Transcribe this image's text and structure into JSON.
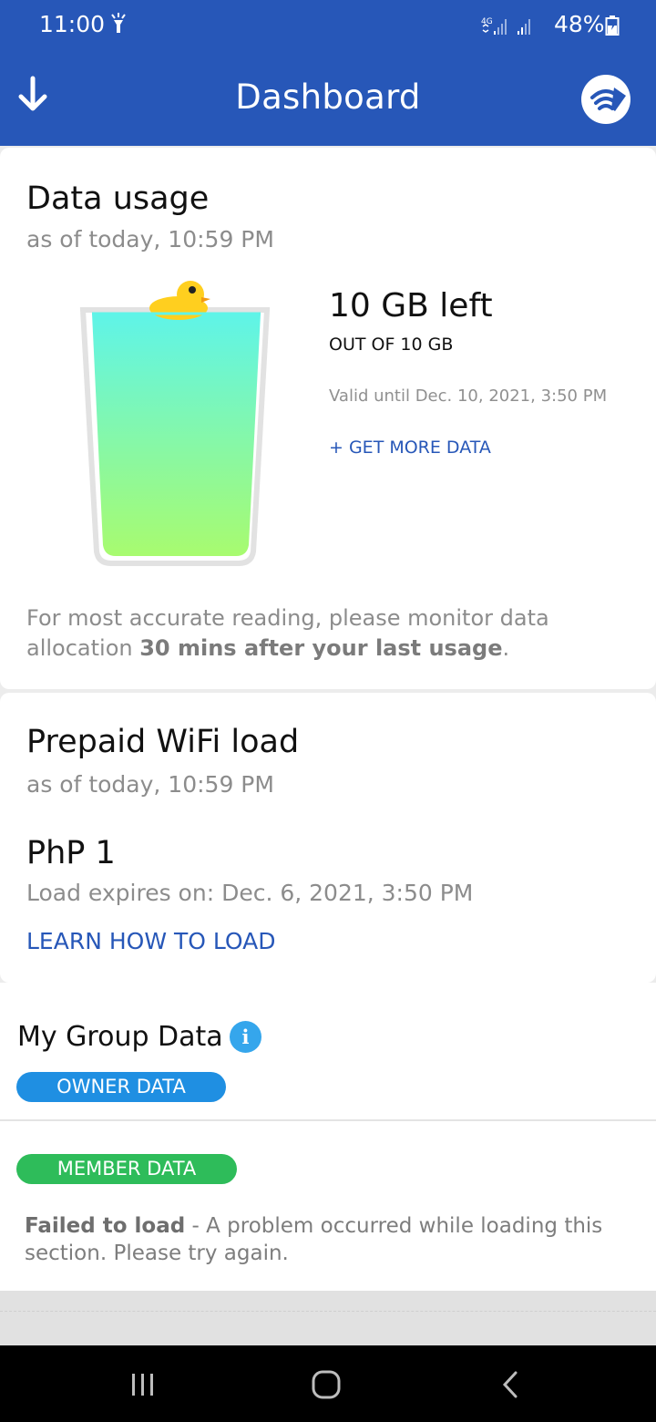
{
  "status_bar": {
    "time": "11:00",
    "battery": "48%",
    "network": "4G"
  },
  "header": {
    "title": "Dashboard"
  },
  "data_usage": {
    "title": "Data usage",
    "as_of": "as of today, 10:59 PM",
    "remaining": "10 GB left",
    "total": "OUT OF 10 GB",
    "valid_until": "Valid until Dec. 10, 2021, 3:50 PM",
    "get_more_label": "+ GET MORE DATA",
    "remaining_fraction": 1.0,
    "note_prefix": "For most accurate reading, please monitor data allocation ",
    "note_bold": "30 mins after your last usage",
    "note_suffix": "."
  },
  "prepaid_wifi": {
    "title": "Prepaid WiFi load",
    "as_of": "as of today, 10:59 PM",
    "amount": "PhP 1",
    "expires": "Load expires on: Dec. 6, 2021, 3:50 PM",
    "learn_label": "LEARN HOW TO LOAD"
  },
  "group_data": {
    "title": "My Group Data",
    "owner_label": "OWNER DATA",
    "member_label": "MEMBER DATA",
    "error_bold": "Failed to load",
    "error_text": " - A problem occurred while loading this section. Please try again."
  },
  "colors": {
    "brand_blue": "#2757b8",
    "owner_blue": "#1f8fe2",
    "member_green": "#2ebc5a",
    "info_blue": "#35a6ec"
  },
  "icons": {
    "download": "download-arrow-icon",
    "wifi_logo": "wifi-logo-icon",
    "flashlight": "flashlight-icon",
    "info": "info-icon",
    "recents": "recents-icon",
    "home": "home-icon",
    "back": "back-icon"
  }
}
